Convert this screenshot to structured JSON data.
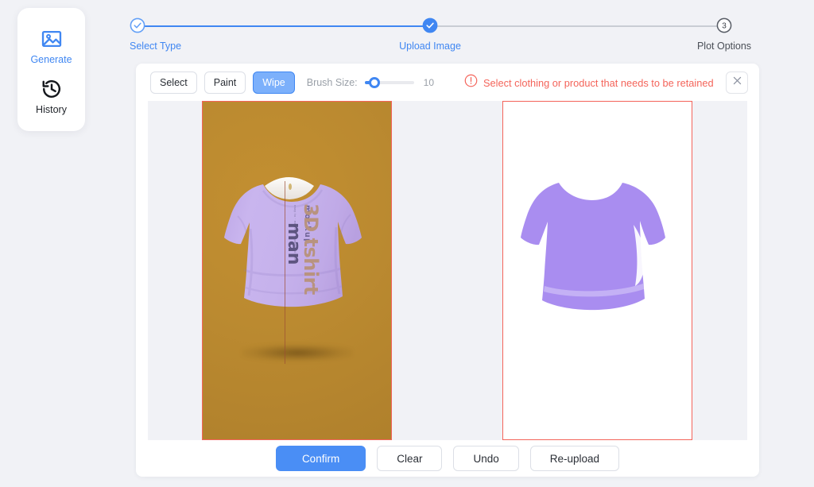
{
  "app": {
    "background_color": "#f1f2f6",
    "accent_color": "#4087f2",
    "danger_color": "#f4645a"
  },
  "sidebar": {
    "items": [
      {
        "label": "Generate",
        "icon": "image-icon",
        "active": true
      },
      {
        "label": "History",
        "icon": "history-clock-icon",
        "active": false
      }
    ]
  },
  "stepper": {
    "steps": [
      {
        "index": "1",
        "label": "Select Type",
        "state": "done"
      },
      {
        "index": "2",
        "label": "Upload Image",
        "state": "done"
      },
      {
        "index": "3",
        "label": "Plot Options",
        "state": "todo"
      }
    ]
  },
  "toolbar": {
    "tools": [
      {
        "label": "Select",
        "selected": false
      },
      {
        "label": "Paint",
        "selected": false
      },
      {
        "label": "Wipe",
        "selected": true
      }
    ],
    "brush": {
      "label": "Brush Size:",
      "value": "10",
      "min": "1",
      "max": "50",
      "percent": 20
    },
    "warning": {
      "icon": "exclamation-circle-icon",
      "text": "Select clothing or product that needs to be retained"
    },
    "close": {
      "icon": "close-icon",
      "label": ""
    }
  },
  "canvas": {
    "left_pane": {
      "name": "source-image",
      "background_color": "#bb8a30",
      "garment_color": "#c5b1ea",
      "overlay_text": {
        "mockup": "mockup",
        "title": "3D tshirt",
        "subject": "man",
        "fine_print": "easy to\nedit file\n\nfree to\ndownload\nat\nfreepik"
      }
    },
    "right_pane": {
      "name": "extracted-mask-preview",
      "background_color": "#ffffff",
      "mask_color": "#a98df0"
    }
  },
  "footer": {
    "buttons": [
      {
        "label": "Confirm",
        "variant": "primary"
      },
      {
        "label": "Clear",
        "variant": "default"
      },
      {
        "label": "Undo",
        "variant": "default"
      },
      {
        "label": "Re-upload",
        "variant": "default"
      }
    ]
  }
}
